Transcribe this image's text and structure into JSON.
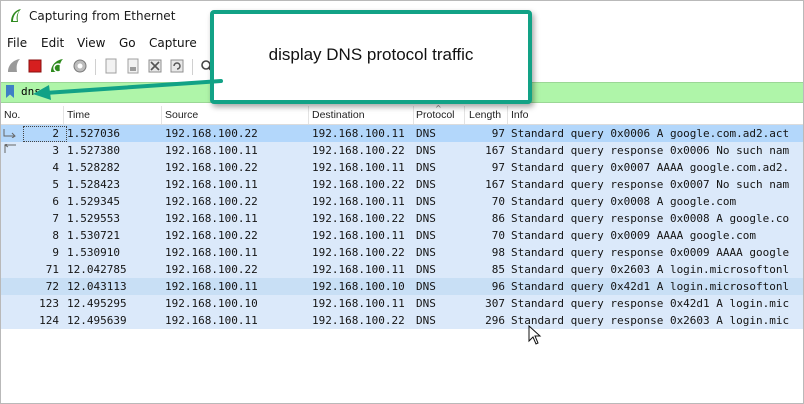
{
  "window": {
    "title": "Capturing from Ethernet"
  },
  "menu": [
    "File",
    "Edit",
    "View",
    "Go",
    "Capture"
  ],
  "toolbar": {
    "icons": [
      "shark-fin-start-icon",
      "stop-capture-icon",
      "restart-capture-icon",
      "capture-options-icon",
      "open-file-icon",
      "save-file-icon",
      "close-file-icon",
      "reload-icon",
      "find-icon"
    ]
  },
  "filter": {
    "value": "dns"
  },
  "columns": {
    "no": "No.",
    "time": "Time",
    "source": "Source",
    "destination": "Destination",
    "protocol": "Protocol",
    "length": "Length",
    "info": "Info"
  },
  "packets": [
    {
      "no": "2",
      "time": "1.527036",
      "source": "192.168.100.22",
      "destination": "192.168.100.11",
      "protocol": "DNS",
      "length": "97",
      "info": "Standard query 0x0006 A google.com.ad2.act"
    },
    {
      "no": "3",
      "time": "1.527380",
      "source": "192.168.100.11",
      "destination": "192.168.100.22",
      "protocol": "DNS",
      "length": "167",
      "info": "Standard query response 0x0006 No such nam"
    },
    {
      "no": "4",
      "time": "1.528282",
      "source": "192.168.100.22",
      "destination": "192.168.100.11",
      "protocol": "DNS",
      "length": "97",
      "info": "Standard query 0x0007 AAAA google.com.ad2."
    },
    {
      "no": "5",
      "time": "1.528423",
      "source": "192.168.100.11",
      "destination": "192.168.100.22",
      "protocol": "DNS",
      "length": "167",
      "info": "Standard query response 0x0007 No such nam"
    },
    {
      "no": "6",
      "time": "1.529345",
      "source": "192.168.100.22",
      "destination": "192.168.100.11",
      "protocol": "DNS",
      "length": "70",
      "info": "Standard query 0x0008 A google.com"
    },
    {
      "no": "7",
      "time": "1.529553",
      "source": "192.168.100.11",
      "destination": "192.168.100.22",
      "protocol": "DNS",
      "length": "86",
      "info": "Standard query response 0x0008 A google.co"
    },
    {
      "no": "8",
      "time": "1.530721",
      "source": "192.168.100.22",
      "destination": "192.168.100.11",
      "protocol": "DNS",
      "length": "70",
      "info": "Standard query 0x0009 AAAA google.com"
    },
    {
      "no": "9",
      "time": "1.530910",
      "source": "192.168.100.11",
      "destination": "192.168.100.22",
      "protocol": "DNS",
      "length": "98",
      "info": "Standard query response 0x0009 AAAA google"
    },
    {
      "no": "71",
      "time": "12.042785",
      "source": "192.168.100.22",
      "destination": "192.168.100.11",
      "protocol": "DNS",
      "length": "85",
      "info": "Standard query 0x2603 A login.microsoftonl"
    },
    {
      "no": "72",
      "time": "12.043113",
      "source": "192.168.100.11",
      "destination": "192.168.100.10",
      "protocol": "DNS",
      "length": "96",
      "info": "Standard query 0x42d1 A login.microsoftonl"
    },
    {
      "no": "123",
      "time": "12.495295",
      "source": "192.168.100.10",
      "destination": "192.168.100.11",
      "protocol": "DNS",
      "length": "307",
      "info": "Standard query response 0x42d1 A login.mic"
    },
    {
      "no": "124",
      "time": "12.495639",
      "source": "192.168.100.11",
      "destination": "192.168.100.22",
      "protocol": "DNS",
      "length": "296",
      "info": "Standard query response 0x2603 A login.mic"
    }
  ],
  "callout": {
    "text": "display DNS protocol traffic"
  },
  "colors": {
    "filter_bg": "#aff5a9",
    "row_bg": "#dbe9fa",
    "selected_row_bg": "#b3d7fb",
    "callout_border": "#12a286"
  }
}
